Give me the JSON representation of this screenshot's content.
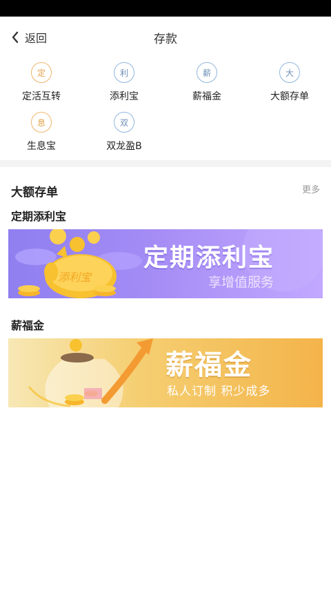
{
  "nav": {
    "back_label": "返回",
    "title": "存款"
  },
  "products": [
    {
      "label": "定活互转",
      "glyph": "定",
      "icon": "transfer-icon"
    },
    {
      "label": "添利宝",
      "glyph": "利",
      "icon": "tianlibao-icon"
    },
    {
      "label": "薪福金",
      "glyph": "薪",
      "icon": "xinfujin-icon"
    },
    {
      "label": "大额存单",
      "glyph": "大",
      "icon": "large-deposit-icon"
    },
    {
      "label": "生息宝",
      "glyph": "息",
      "icon": "shengxibao-icon"
    },
    {
      "label": "双龙盈B",
      "glyph": "双",
      "icon": "shuanglongying-icon"
    }
  ],
  "section": {
    "title": "大额存单",
    "more_label": "更多"
  },
  "cards": [
    {
      "title": "定期添利宝",
      "banner_title": "定期添利宝",
      "banner_subtitle": "享增值服务",
      "piggy_text": "添利宝"
    },
    {
      "title": "薪福金",
      "banner_title": "薪福金",
      "banner_subtitle": "私人订制   积少成多"
    }
  ],
  "colors": {
    "icon_blue": "#8fb6dd",
    "icon_orange": "#f0b56a",
    "banner1_purple": "#9a87f3",
    "banner2_gold": "#f5c45e"
  }
}
